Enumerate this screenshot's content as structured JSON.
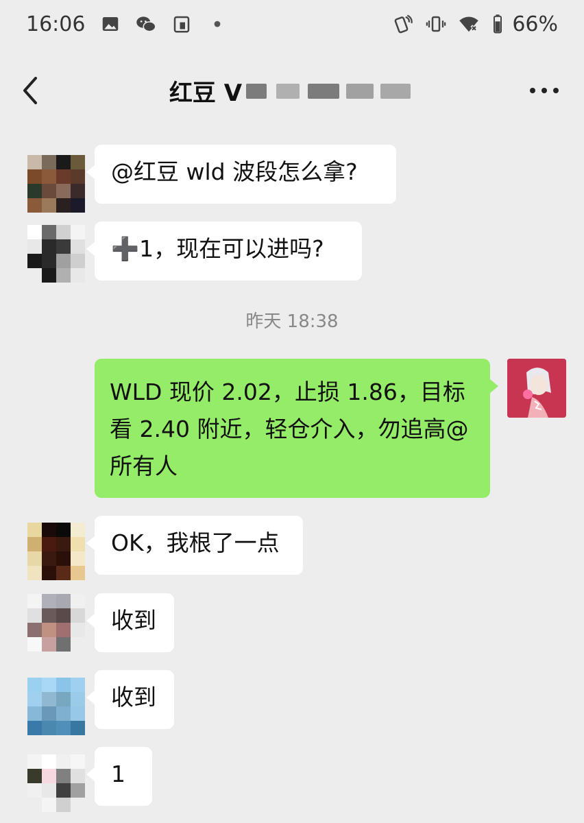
{
  "status_bar": {
    "time": "16:06",
    "battery": "66%",
    "icons_left": [
      "gallery-icon",
      "wechat-icon",
      "clipboard-icon",
      "dot-icon"
    ],
    "icons_right": [
      "nfc-icon",
      "vibrate-icon",
      "wifi-off-icon",
      "battery-icon"
    ]
  },
  "nav": {
    "title": "红豆 V",
    "back_icon": "chevron-left-icon",
    "more_icon": "more-dots-icon"
  },
  "messages": [
    {
      "sender": "other",
      "text": "@红豆  wld 波段怎么拿?"
    },
    {
      "sender": "other",
      "text": "➕1，现在可以进吗?"
    },
    {
      "type": "timestamp",
      "text": "昨天 18:38"
    },
    {
      "sender": "me",
      "text": "WLD 现价 2.02，止损 1.86，目标看 2.40 附近，轻仓介入，勿追高@所有人"
    },
    {
      "sender": "other",
      "text": "OK，我根了一点"
    },
    {
      "sender": "other",
      "text": "收到"
    },
    {
      "sender": "other",
      "text": "收到"
    },
    {
      "sender": "other",
      "text": "1"
    }
  ],
  "colors": {
    "background": "#ededed",
    "bubble_other": "#ffffff",
    "bubble_mine": "#95ec69",
    "scribble": "#e53935"
  }
}
